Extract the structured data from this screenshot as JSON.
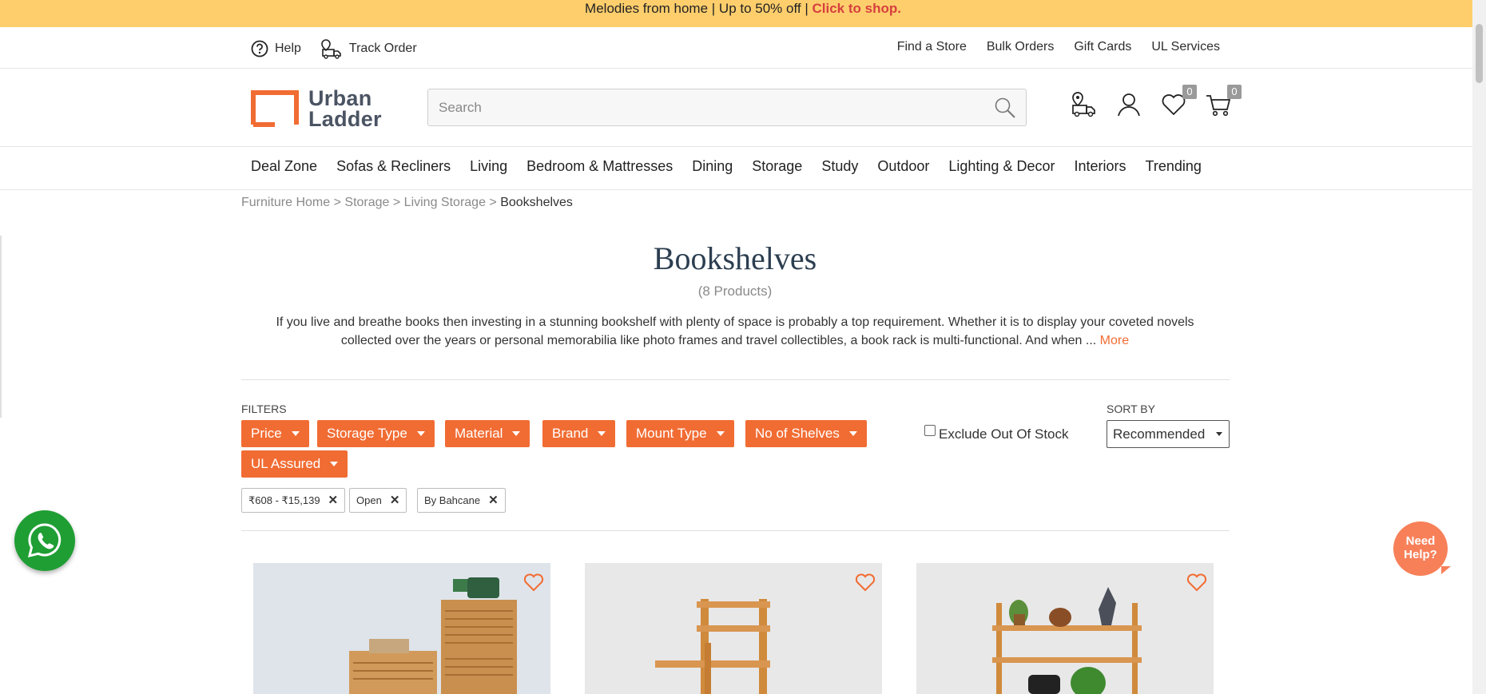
{
  "promo": {
    "text": "Melodies from home | Up to 50% off | ",
    "link": "Click to shop."
  },
  "utility": {
    "help": "Help",
    "track": "Track Order",
    "links": [
      "Find a Store",
      "Bulk Orders",
      "Gift Cards",
      "UL Services"
    ]
  },
  "logo": {
    "line1": "Urban",
    "line2": "Ladder"
  },
  "search": {
    "placeholder": "Search"
  },
  "header_icons": {
    "wishlist_count": "0",
    "cart_count": "0"
  },
  "nav": [
    "Deal Zone",
    "Sofas & Recliners",
    "Living",
    "Bedroom & Mattresses",
    "Dining",
    "Storage",
    "Study",
    "Outdoor",
    "Lighting & Decor",
    "Interiors",
    "Trending"
  ],
  "breadcrumb": {
    "items": [
      "Furniture Home",
      "Storage",
      "Living Storage"
    ],
    "current": "Bookshelves",
    "sep": " > "
  },
  "page": {
    "title": "Bookshelves",
    "count": "(8 Products)",
    "description": "If you live and breathe books then investing in a stunning bookshelf with plenty of space is probably a top requirement. Whether it is to display your coveted novels collected over the years or personal memorabilia like photo frames and travel collectibles, a book rack is multi-functional. And when ...",
    "more": "More"
  },
  "filters": {
    "label": "FILTERS",
    "buttons": [
      "Price",
      "Storage Type",
      "Material",
      "Brand",
      "Mount Type",
      "No of Shelves",
      "UL Assured"
    ],
    "applied": [
      "₹608 - ₹15,139",
      "Open",
      "By Bahcane"
    ],
    "exclude_oos": "Exclude Out Of Stock"
  },
  "sort": {
    "label": "SORT BY",
    "value": "Recommended"
  },
  "help_bubble": {
    "line1": "Need",
    "line2": "Help?"
  },
  "colors": {
    "accent": "#f16c33",
    "promo_bg": "#fece6c",
    "whatsapp": "#1f9e34"
  }
}
